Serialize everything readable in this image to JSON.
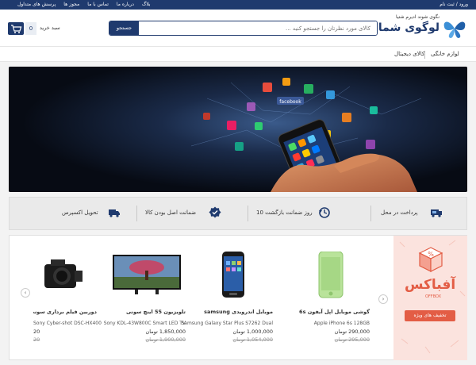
{
  "topbar": {
    "account_label": "ورود / ثبت نام",
    "links": [
      "بلاگ",
      "درباره ما",
      "تماس با ما",
      "مجوز ها",
      "پرسش های متداول"
    ]
  },
  "logo": {
    "tagline": "نگوی شوند ادیرم شتیا",
    "name": "لوگوی شما"
  },
  "search": {
    "placeholder": "کالای مورد نظرتان را جستجو کنید ...",
    "button_label": "جستجو"
  },
  "cart": {
    "count": "0",
    "label": "سبد خرید"
  },
  "nav": {
    "categories": [
      "لوازم خانگی",
      "کالای دیجیتال"
    ]
  },
  "banner": {
    "app_label": "facebook"
  },
  "features": [
    {
      "label": "پرداخت در محل",
      "icon": "truck-pay-icon"
    },
    {
      "label": "10 روز ضمانت بازگشت",
      "icon": "return-icon"
    },
    {
      "label": "ضمانت اصل بودن کالا",
      "icon": "verified-icon"
    },
    {
      "label": "تحویل اکسپرس",
      "icon": "delivery-truck-icon"
    }
  ],
  "offbox": {
    "title": "آفباکس",
    "subtitle": "OFFBOX",
    "button_label": "تخفیف های ویژه"
  },
  "products": [
    {
      "title": "گوشی موبایل اپل آیفون 6s",
      "en_name": "Apple iPhone 6s 128GB",
      "price": "290,000 تومان",
      "old_price": "295,000 تومان",
      "image": "iphone"
    },
    {
      "title": "موبایل اندرویدی samsung",
      "en_name": "Samsung Galaxy Star Plus S7262 Dual",
      "price": "1,000,000 تومان",
      "old_price": "1,054,000 تومان",
      "image": "samsung"
    },
    {
      "title": "تلویزیون 55 اینچ سونی",
      "en_name": "Sony KDL-43W800C Smart LED TV",
      "price": "1,850,000 تومان",
      "old_price": "1,900,000 تومان",
      "image": "tv"
    },
    {
      "title": "دوربین فیلم برداری سونی",
      "en_name": "Sony Cyber-shot DSC-HX400",
      "price": "20",
      "old_price": "20",
      "image": "camera"
    }
  ],
  "colors": {
    "brand": "#1f3a6e",
    "accent": "#e35d45"
  }
}
